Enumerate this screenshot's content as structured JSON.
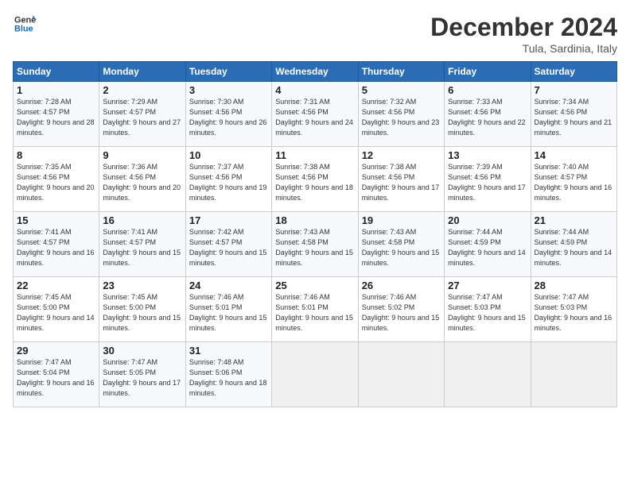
{
  "logo": {
    "line1": "General",
    "line2": "Blue"
  },
  "title": "December 2024",
  "location": "Tula, Sardinia, Italy",
  "weekdays": [
    "Sunday",
    "Monday",
    "Tuesday",
    "Wednesday",
    "Thursday",
    "Friday",
    "Saturday"
  ],
  "days": [
    {
      "date": "",
      "info": ""
    },
    {
      "date": "",
      "info": ""
    },
    {
      "date": "",
      "info": ""
    },
    {
      "date": "",
      "info": ""
    },
    {
      "date": "",
      "info": ""
    },
    {
      "date": "",
      "info": ""
    },
    {
      "date": "7",
      "sunrise": "Sunrise: 7:34 AM",
      "sunset": "Sunset: 4:56 PM",
      "daylight": "Daylight: 9 hours and 21 minutes."
    },
    {
      "date": "1",
      "sunrise": "Sunrise: 7:28 AM",
      "sunset": "Sunset: 4:57 PM",
      "daylight": "Daylight: 9 hours and 28 minutes."
    },
    {
      "date": "2",
      "sunrise": "Sunrise: 7:29 AM",
      "sunset": "Sunset: 4:57 PM",
      "daylight": "Daylight: 9 hours and 27 minutes."
    },
    {
      "date": "3",
      "sunrise": "Sunrise: 7:30 AM",
      "sunset": "Sunset: 4:56 PM",
      "daylight": "Daylight: 9 hours and 26 minutes."
    },
    {
      "date": "4",
      "sunrise": "Sunrise: 7:31 AM",
      "sunset": "Sunset: 4:56 PM",
      "daylight": "Daylight: 9 hours and 24 minutes."
    },
    {
      "date": "5",
      "sunrise": "Sunrise: 7:32 AM",
      "sunset": "Sunset: 4:56 PM",
      "daylight": "Daylight: 9 hours and 23 minutes."
    },
    {
      "date": "6",
      "sunrise": "Sunrise: 7:33 AM",
      "sunset": "Sunset: 4:56 PM",
      "daylight": "Daylight: 9 hours and 22 minutes."
    },
    {
      "date": "7",
      "sunrise": "Sunrise: 7:34 AM",
      "sunset": "Sunset: 4:56 PM",
      "daylight": "Daylight: 9 hours and 21 minutes."
    },
    {
      "date": "8",
      "sunrise": "Sunrise: 7:35 AM",
      "sunset": "Sunset: 4:56 PM",
      "daylight": "Daylight: 9 hours and 20 minutes."
    },
    {
      "date": "9",
      "sunrise": "Sunrise: 7:36 AM",
      "sunset": "Sunset: 4:56 PM",
      "daylight": "Daylight: 9 hours and 20 minutes."
    },
    {
      "date": "10",
      "sunrise": "Sunrise: 7:37 AM",
      "sunset": "Sunset: 4:56 PM",
      "daylight": "Daylight: 9 hours and 19 minutes."
    },
    {
      "date": "11",
      "sunrise": "Sunrise: 7:38 AM",
      "sunset": "Sunset: 4:56 PM",
      "daylight": "Daylight: 9 hours and 18 minutes."
    },
    {
      "date": "12",
      "sunrise": "Sunrise: 7:38 AM",
      "sunset": "Sunset: 4:56 PM",
      "daylight": "Daylight: 9 hours and 17 minutes."
    },
    {
      "date": "13",
      "sunrise": "Sunrise: 7:39 AM",
      "sunset": "Sunset: 4:56 PM",
      "daylight": "Daylight: 9 hours and 17 minutes."
    },
    {
      "date": "14",
      "sunrise": "Sunrise: 7:40 AM",
      "sunset": "Sunset: 4:57 PM",
      "daylight": "Daylight: 9 hours and 16 minutes."
    },
    {
      "date": "15",
      "sunrise": "Sunrise: 7:41 AM",
      "sunset": "Sunset: 4:57 PM",
      "daylight": "Daylight: 9 hours and 16 minutes."
    },
    {
      "date": "16",
      "sunrise": "Sunrise: 7:41 AM",
      "sunset": "Sunset: 4:57 PM",
      "daylight": "Daylight: 9 hours and 15 minutes."
    },
    {
      "date": "17",
      "sunrise": "Sunrise: 7:42 AM",
      "sunset": "Sunset: 4:57 PM",
      "daylight": "Daylight: 9 hours and 15 minutes."
    },
    {
      "date": "18",
      "sunrise": "Sunrise: 7:43 AM",
      "sunset": "Sunset: 4:58 PM",
      "daylight": "Daylight: 9 hours and 15 minutes."
    },
    {
      "date": "19",
      "sunrise": "Sunrise: 7:43 AM",
      "sunset": "Sunset: 4:58 PM",
      "daylight": "Daylight: 9 hours and 15 minutes."
    },
    {
      "date": "20",
      "sunrise": "Sunrise: 7:44 AM",
      "sunset": "Sunset: 4:59 PM",
      "daylight": "Daylight: 9 hours and 14 minutes."
    },
    {
      "date": "21",
      "sunrise": "Sunrise: 7:44 AM",
      "sunset": "Sunset: 4:59 PM",
      "daylight": "Daylight: 9 hours and 14 minutes."
    },
    {
      "date": "22",
      "sunrise": "Sunrise: 7:45 AM",
      "sunset": "Sunset: 5:00 PM",
      "daylight": "Daylight: 9 hours and 14 minutes."
    },
    {
      "date": "23",
      "sunrise": "Sunrise: 7:45 AM",
      "sunset": "Sunset: 5:00 PM",
      "daylight": "Daylight: 9 hours and 15 minutes."
    },
    {
      "date": "24",
      "sunrise": "Sunrise: 7:46 AM",
      "sunset": "Sunset: 5:01 PM",
      "daylight": "Daylight: 9 hours and 15 minutes."
    },
    {
      "date": "25",
      "sunrise": "Sunrise: 7:46 AM",
      "sunset": "Sunset: 5:01 PM",
      "daylight": "Daylight: 9 hours and 15 minutes."
    },
    {
      "date": "26",
      "sunrise": "Sunrise: 7:46 AM",
      "sunset": "Sunset: 5:02 PM",
      "daylight": "Daylight: 9 hours and 15 minutes."
    },
    {
      "date": "27",
      "sunrise": "Sunrise: 7:47 AM",
      "sunset": "Sunset: 5:03 PM",
      "daylight": "Daylight: 9 hours and 15 minutes."
    },
    {
      "date": "28",
      "sunrise": "Sunrise: 7:47 AM",
      "sunset": "Sunset: 5:03 PM",
      "daylight": "Daylight: 9 hours and 16 minutes."
    },
    {
      "date": "29",
      "sunrise": "Sunrise: 7:47 AM",
      "sunset": "Sunset: 5:04 PM",
      "daylight": "Daylight: 9 hours and 16 minutes."
    },
    {
      "date": "30",
      "sunrise": "Sunrise: 7:47 AM",
      "sunset": "Sunset: 5:05 PM",
      "daylight": "Daylight: 9 hours and 17 minutes."
    },
    {
      "date": "31",
      "sunrise": "Sunrise: 7:48 AM",
      "sunset": "Sunset: 5:06 PM",
      "daylight": "Daylight: 9 hours and 18 minutes."
    }
  ]
}
